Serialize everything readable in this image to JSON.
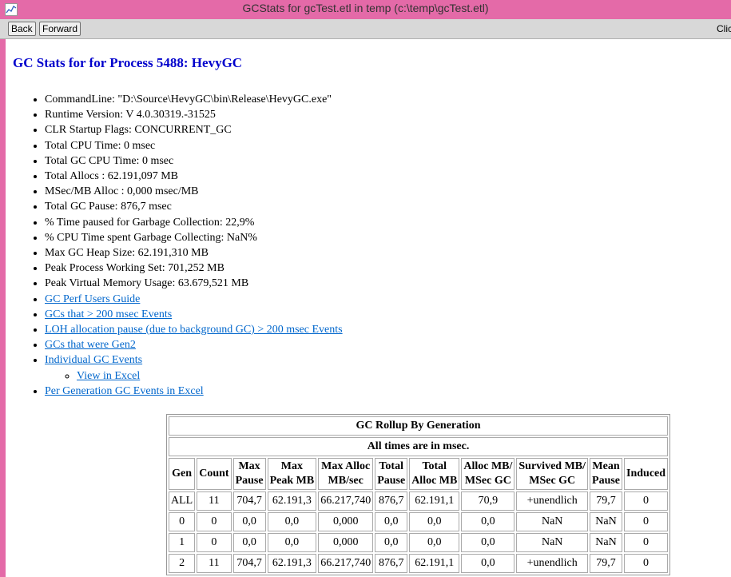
{
  "window": {
    "title": "GCStats for gcTest.etl in temp (c:\\temp\\gcTest.etl)"
  },
  "toolbar": {
    "back_label": "Back",
    "forward_label": "Forward",
    "right_text": "Click"
  },
  "page": {
    "heading": "GC Stats for for Process 5488: HevyGC",
    "info": [
      "CommandLine: \"D:\\Source\\HevyGC\\bin\\Release\\HevyGC.exe\"",
      "Runtime Version: V 4.0.30319.-31525",
      "CLR Startup Flags: CONCURRENT_GC",
      "Total CPU Time: 0 msec",
      "Total GC CPU Time: 0 msec",
      "Total Allocs : 62.191,097 MB",
      "MSec/MB Alloc : 0,000 msec/MB",
      "Total GC Pause: 876,7 msec",
      "% Time paused for Garbage Collection: 22,9%",
      "% CPU Time spent Garbage Collecting: NaN%",
      "Max GC Heap Size: 62.191,310 MB",
      "Peak Process Working Set: 701,252 MB",
      "Peak Virtual Memory Usage: 63.679,521 MB"
    ],
    "links": {
      "users_guide": "GC Perf Users Guide",
      "gcs_200": "GCs that > 200 msec Events",
      "loh_pause": "LOH allocation pause (due to background GC) > 200 msec Events",
      "gen2": "GCs that were Gen2",
      "individual": "Individual GC Events",
      "view_excel": "View in Excel",
      "per_gen_excel": "Per Generation GC Events in Excel"
    }
  },
  "rollup": {
    "title": "GC Rollup By Generation",
    "subtitle": "All times are in msec.",
    "headers": [
      [
        "Gen"
      ],
      [
        "Count"
      ],
      [
        "Max",
        "Pause"
      ],
      [
        "Max",
        "Peak MB"
      ],
      [
        "Max Alloc",
        "MB/sec"
      ],
      [
        "Total",
        "Pause"
      ],
      [
        "Total",
        "Alloc MB"
      ],
      [
        "Alloc MB/",
        "MSec GC"
      ],
      [
        "Survived MB/",
        "MSec GC"
      ],
      [
        "Mean",
        "Pause"
      ],
      [
        "Induced"
      ]
    ],
    "rows": [
      [
        "ALL",
        "11",
        "704,7",
        "62.191,3",
        "66.217,740",
        "876,7",
        "62.191,1",
        "70,9",
        "+unendlich",
        "79,7",
        "0"
      ],
      [
        "0",
        "0",
        "0,0",
        "0,0",
        "0,000",
        "0,0",
        "0,0",
        "0,0",
        "NaN",
        "NaN",
        "0"
      ],
      [
        "1",
        "0",
        "0,0",
        "0,0",
        "0,000",
        "0,0",
        "0,0",
        "0,0",
        "NaN",
        "NaN",
        "0"
      ],
      [
        "2",
        "11",
        "704,7",
        "62.191,3",
        "66.217,740",
        "876,7",
        "62.191,1",
        "0,0",
        "+unendlich",
        "79,7",
        "0"
      ]
    ]
  }
}
